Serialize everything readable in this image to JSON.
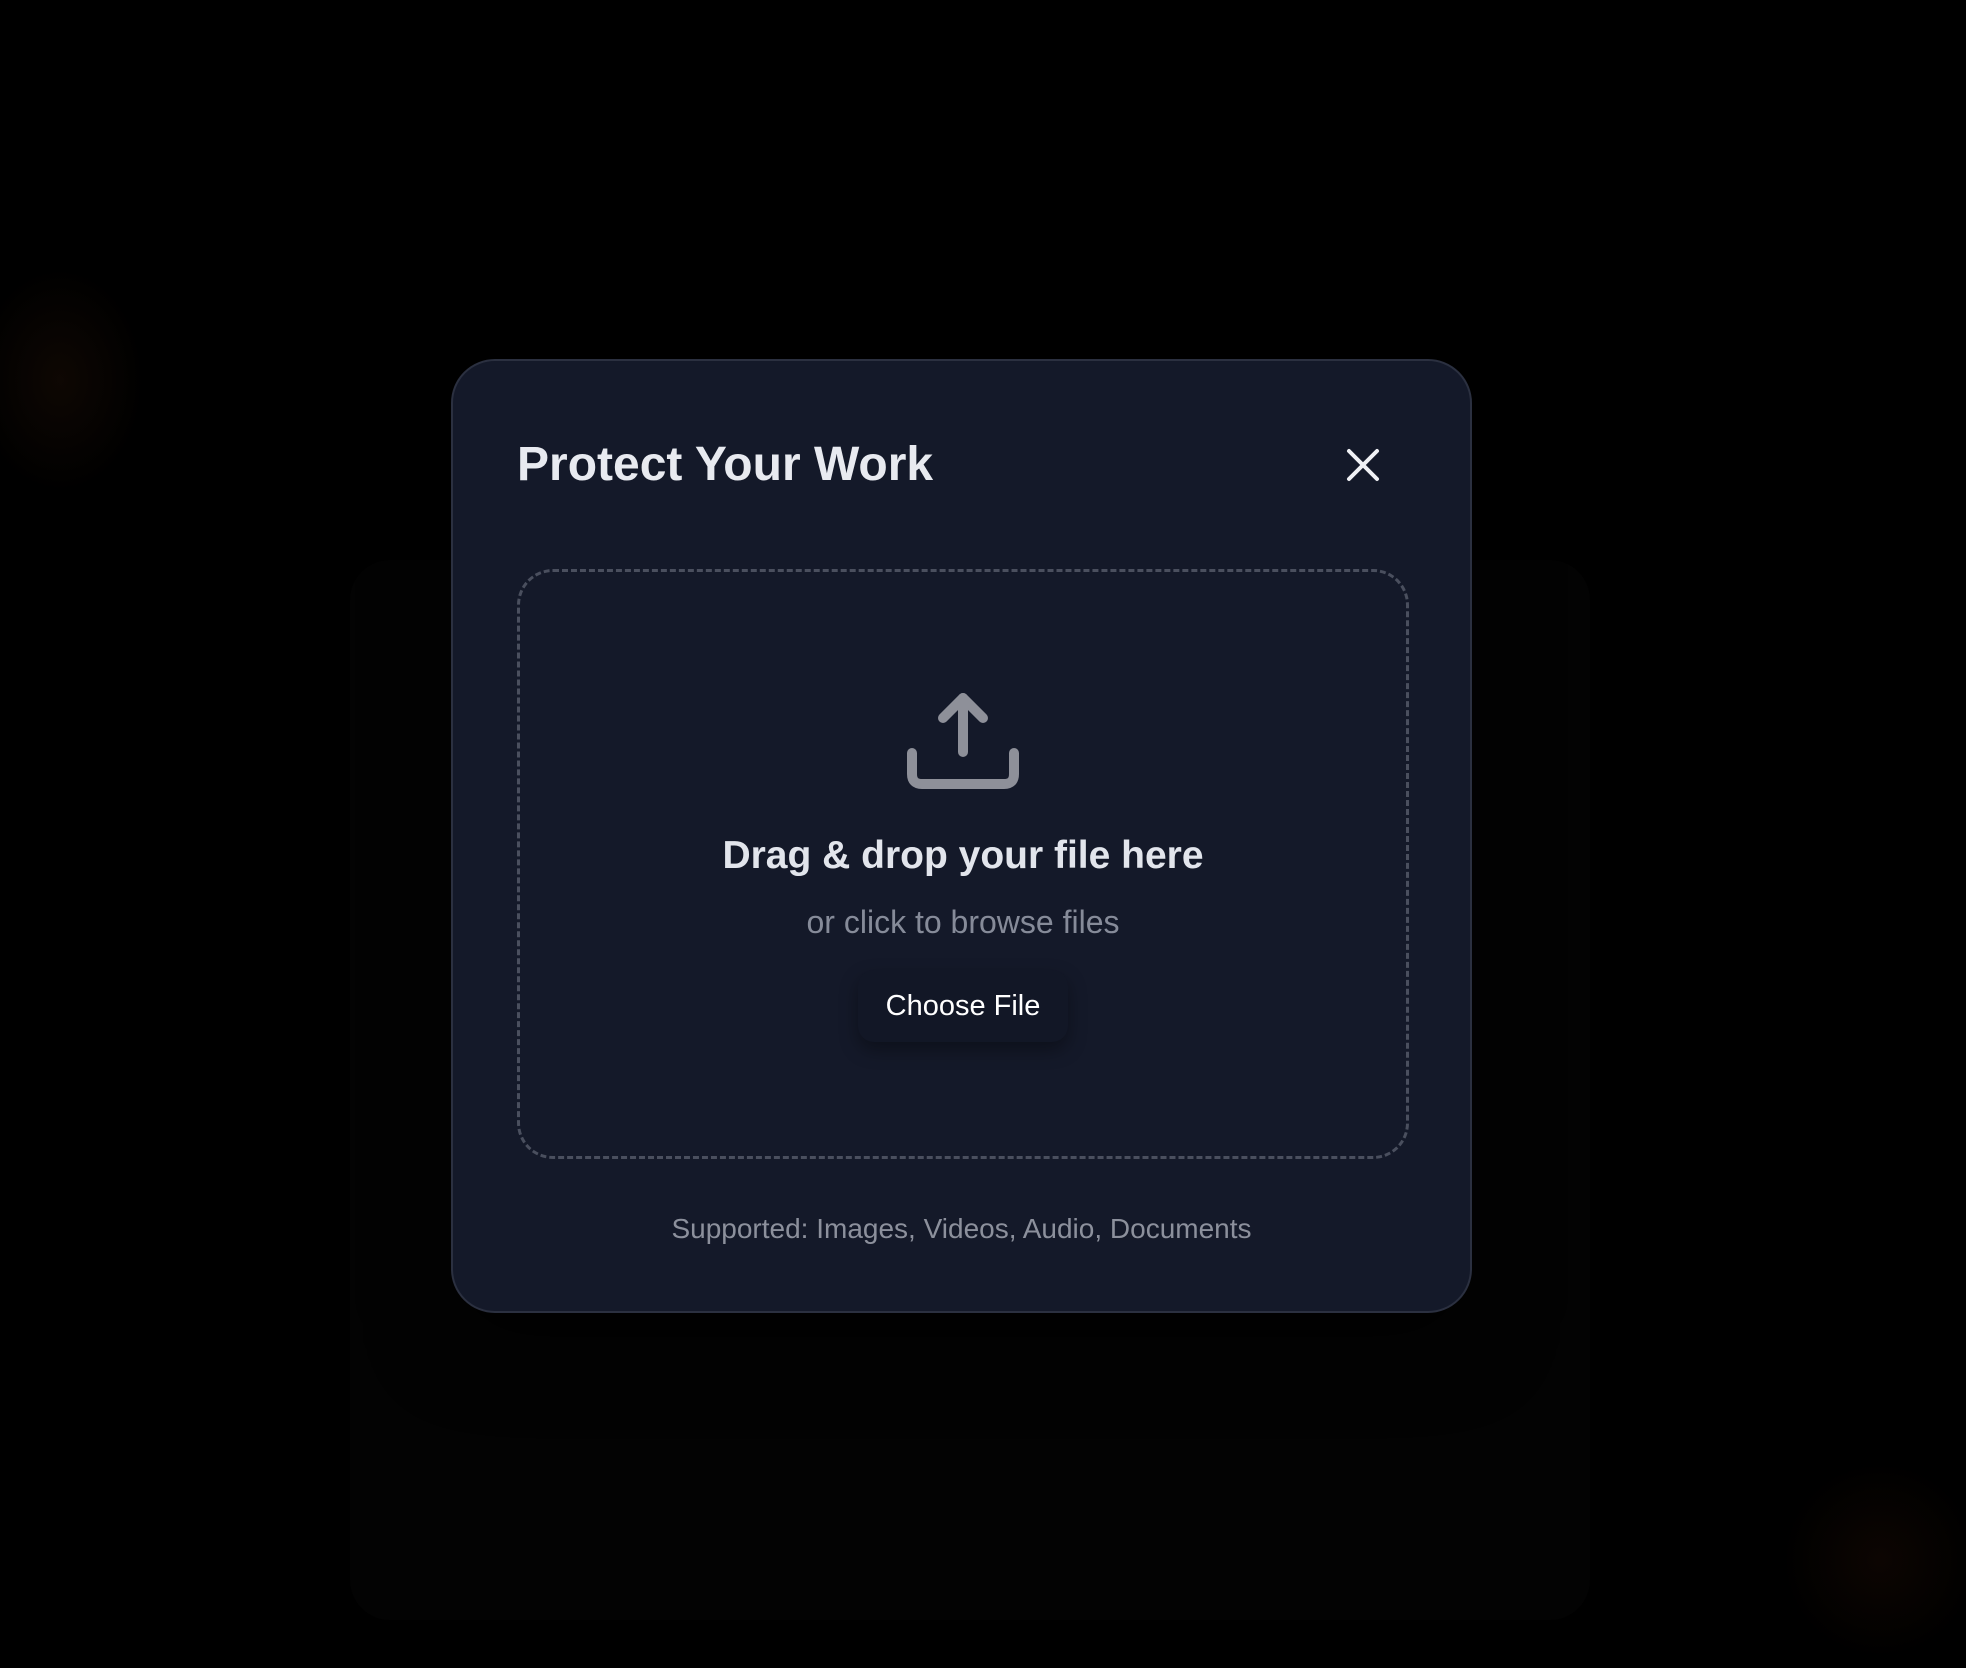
{
  "modal": {
    "title": "Protect Your Work",
    "close_icon": "close-icon"
  },
  "dropzone": {
    "icon": "upload-icon",
    "title": "Drag & drop your file here",
    "subtitle": "or click to browse files",
    "button_label": "Choose File"
  },
  "footer": {
    "supported_text": "Supported: Images, Videos, Audio, Documents"
  },
  "colors": {
    "page_background": "#000000",
    "modal_background": "#141929",
    "modal_border": "#2b3040",
    "dashed_border": "#4a4f5e",
    "title_text": "#e8eaf0",
    "muted_text": "#868b99",
    "icon_gray": "#8e9099"
  }
}
